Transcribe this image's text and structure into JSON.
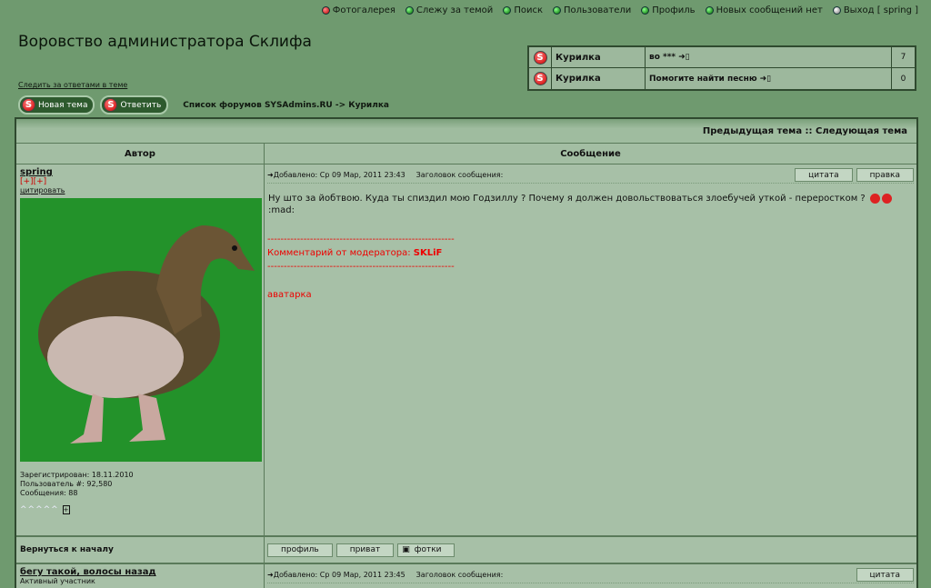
{
  "topnav": [
    {
      "label": "Фотогалерея",
      "icon": "red-ball-icon"
    },
    {
      "label": "Слежу за темой",
      "icon": "green-ball-icon"
    },
    {
      "label": "Поиск",
      "icon": "green-ball-icon"
    },
    {
      "label": "Пользователи",
      "icon": "green-ball-icon"
    },
    {
      "label": "Профиль",
      "icon": "green-ball-icon"
    },
    {
      "label": "Новых сообщений нет",
      "icon": "green-ball-icon"
    },
    {
      "label": "Выход [ spring ]",
      "icon": "clock-icon"
    }
  ],
  "page_title": "Воровство администратора Склифа",
  "watch_link": "Следить за ответами в теме",
  "recent": [
    {
      "forum": "Курилка",
      "topic": "во ***",
      "count": "7"
    },
    {
      "forum": "Курилка",
      "topic": "Помогите найти песню",
      "count": "0"
    }
  ],
  "actions": {
    "new_topic": "Новая тема",
    "reply": "Ответить"
  },
  "breadcrumb": "Список форумов SYSAdmins.RU -> Курилка",
  "nav_topics": "Предыдущая тема :: Следующая тема",
  "headers": {
    "author": "Автор",
    "message": "Сообщение"
  },
  "post1": {
    "author": "spring",
    "plus": "[+][+]",
    "quote": "цитировать",
    "added": "Добавлено: Ср 09 Мар, 2011 23:43",
    "subject_label": "Заголовок сообщения:",
    "btn_quote": "цитата",
    "btn_edit": "правка",
    "text_line1": "Ну што за йобтвою. Куда ты спиздил мою Годзиллу ? Почему я должен довольствоваться злоебучей уткой - переростком ?",
    "text_line2": ":mad:",
    "separator": "---------------------------------------------------------",
    "mod_comment_label": "Комментарий от модератора: ",
    "mod_name": "SKLiF",
    "avatar_word": "аватарка",
    "registered": "Зарегистрирован: 18.11.2010",
    "user_no": "Пользователь #: 92,580",
    "posts": "Сообщения: 88",
    "rank": "^^^^^"
  },
  "footer": {
    "back_top": "Вернуться к началу",
    "profile": "профиль",
    "private": "приват",
    "photos": "фотки"
  },
  "post2": {
    "author": "бегу такой, волосы назад",
    "status": "Активный участник",
    "added": "Добавлено: Ср 09 Мар, 2011 23:45",
    "subject_label": "Заголовок сообщения:",
    "btn_quote": "цитата"
  }
}
